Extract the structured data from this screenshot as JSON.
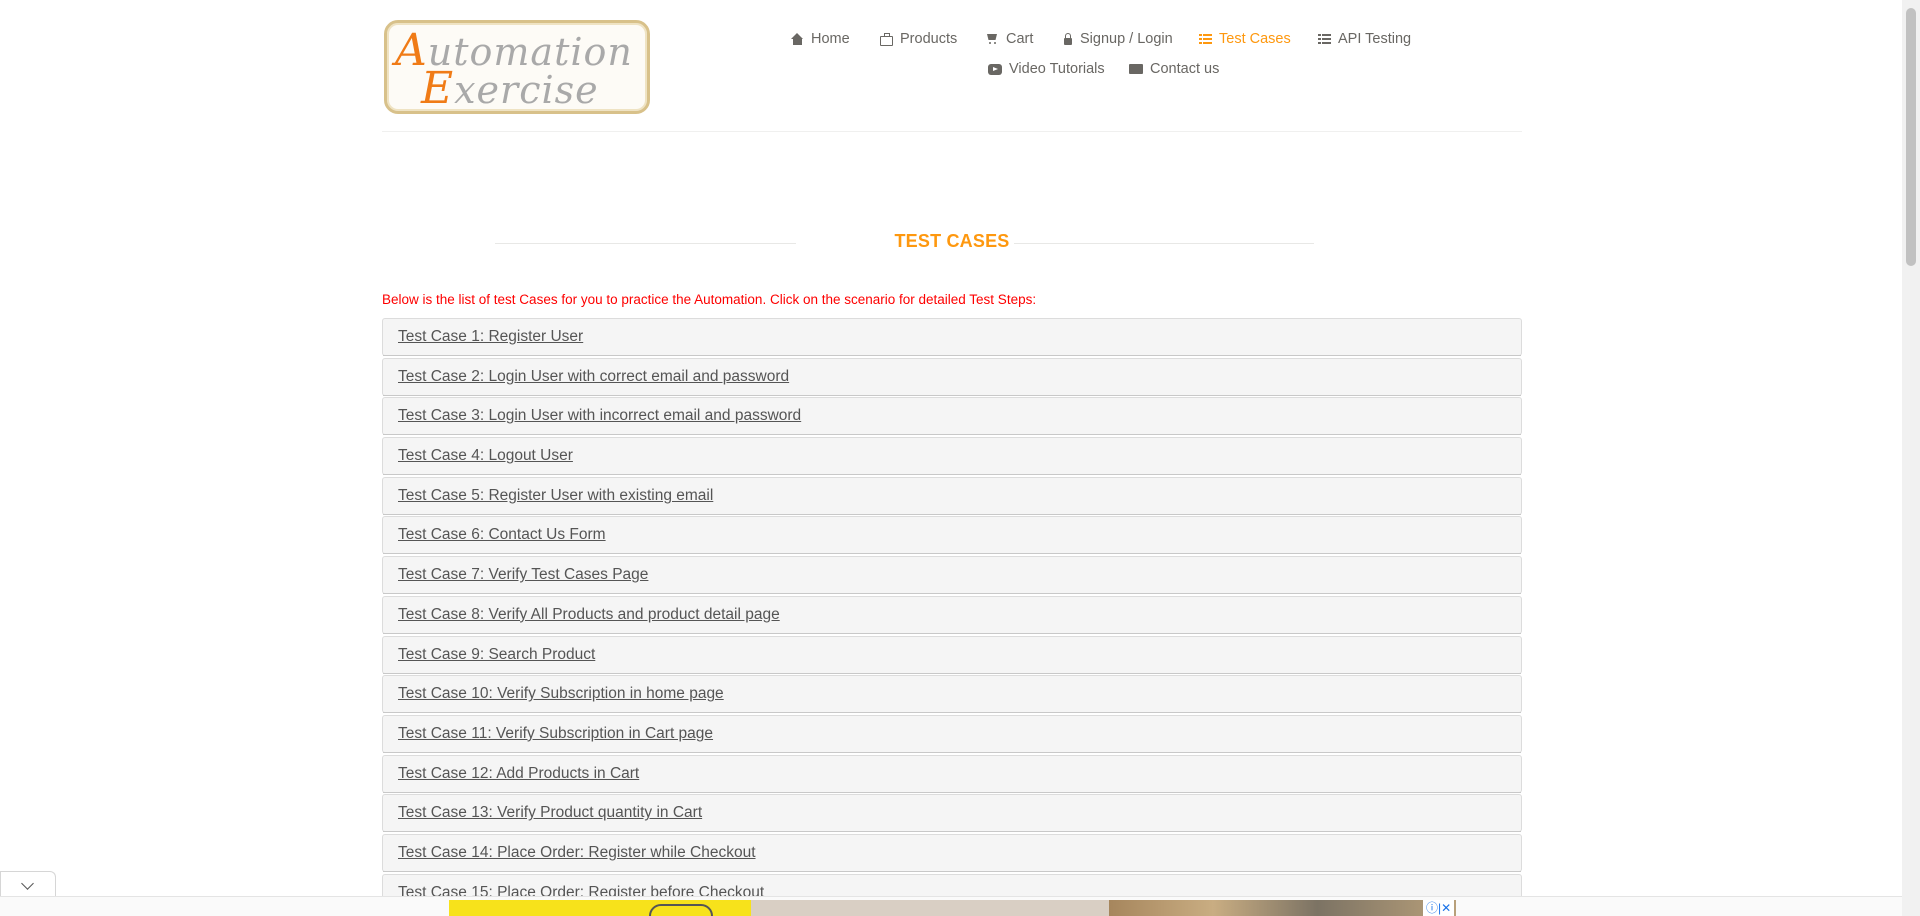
{
  "header": {
    "logo": {
      "line1_cap": "A",
      "line1_rest": "utomation",
      "line2_cap": "E",
      "line2_rest": "xercise"
    },
    "nav": [
      {
        "label": "Home",
        "icon": "home-icon",
        "active": false
      },
      {
        "label": "Products",
        "icon": "products-icon",
        "active": false
      },
      {
        "label": "Cart",
        "icon": "cart-icon",
        "active": false
      },
      {
        "label": "Signup / Login",
        "icon": "lock-icon",
        "active": false
      },
      {
        "label": "Test Cases",
        "icon": "list-icon",
        "active": true
      },
      {
        "label": "API Testing",
        "icon": "list-icon",
        "active": false
      },
      {
        "label": "Video Tutorials",
        "icon": "youtube-icon",
        "active": false
      },
      {
        "label": "Contact us",
        "icon": "envelope-icon",
        "active": false
      }
    ]
  },
  "main": {
    "title": "TEST CASES",
    "intro": "Below is the list of test Cases for you to practice the Automation. Click on the scenario for detailed Test Steps:",
    "test_cases": [
      "Test Case 1: Register User",
      "Test Case 2: Login User with correct email and password",
      "Test Case 3: Login User with incorrect email and password",
      "Test Case 4: Logout User",
      "Test Case 5: Register User with existing email",
      "Test Case 6: Contact Us Form",
      "Test Case 7: Verify Test Cases Page",
      "Test Case 8: Verify All Products and product detail page",
      "Test Case 9: Search Product",
      "Test Case 10: Verify Subscription in home page",
      "Test Case 11: Verify Subscription in Cart page",
      "Test Case 12: Add Products in Cart",
      "Test Case 13: Verify Product quantity in Cart",
      "Test Case 14: Place Order: Register while Checkout",
      "Test Case 15: Place Order: Register before Checkout"
    ]
  },
  "colors": {
    "accent": "#fe980f",
    "intro_text": "#fe0000",
    "nav_text": "#696763",
    "row_bg": "#f5f5f5"
  },
  "ad": {
    "controls": "ⓘ|✕"
  }
}
